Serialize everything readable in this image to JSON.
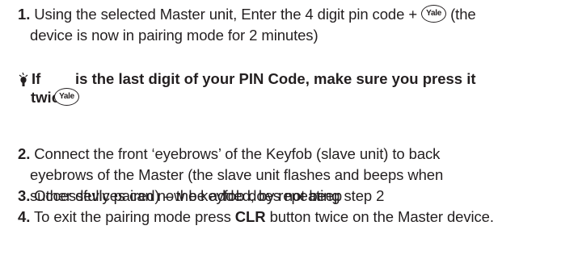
{
  "steps": [
    {
      "number": "1.",
      "line1_before": "Using the selected Master unit, Enter the 4 digit pin code +",
      "line1_after": "(the",
      "line2": "device is now in pairing mode for 2 minutes)"
    },
    {
      "number": "2.",
      "line1": "Connect the front ‘eyebrows’ of the Keyfob (slave unit) to back",
      "line2": "eyebrows of the Master (the slave unit flashes and beeps when",
      "line3": "successfully paired) – the keyfob does not beep"
    },
    {
      "number": "3.",
      "text": "Other devices can now be added, by repeating step 2"
    },
    {
      "number": "4.",
      "before": "To exit the pairing mode press",
      "bold": "CLR",
      "after": "button twice on the Master device."
    }
  ],
  "tip": {
    "word_if": "If",
    "text": "is the last digit of your PIN Code, make sure you press it",
    "line2": "twice",
    "icon": "lightbulb-icon"
  },
  "yale_badge_label": "Yale",
  "colors": {
    "text": "#231f20",
    "background": "#ffffff"
  }
}
